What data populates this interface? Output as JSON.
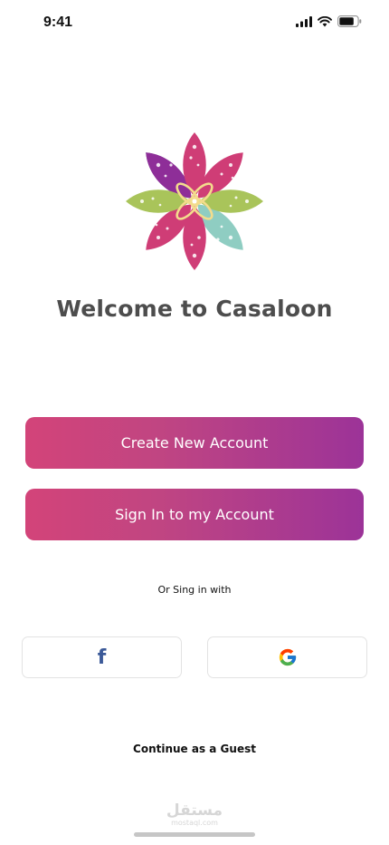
{
  "status_bar": {
    "time": "9:41"
  },
  "welcome": {
    "title": "Welcome to Casaloon"
  },
  "buttons": {
    "create_account": "Create New Account",
    "sign_in": "Sign In to my Account"
  },
  "social": {
    "prompt": "Or Sing in with",
    "facebook_icon": "facebook-icon",
    "google_icon": "google-icon"
  },
  "guest": {
    "label": "Continue as a Guest"
  },
  "watermark": {
    "main": "مستقل",
    "sub": "mostaql.com"
  },
  "colors": {
    "gradient_start": "#d34479",
    "gradient_end": "#9c3398",
    "title": "#4d4d4d",
    "logo_pink": "#cf3d76",
    "logo_purple": "#8e2e98",
    "logo_teal": "#8fcdc2",
    "logo_green": "#a9c45a",
    "logo_outline": "#f3dc8c"
  }
}
